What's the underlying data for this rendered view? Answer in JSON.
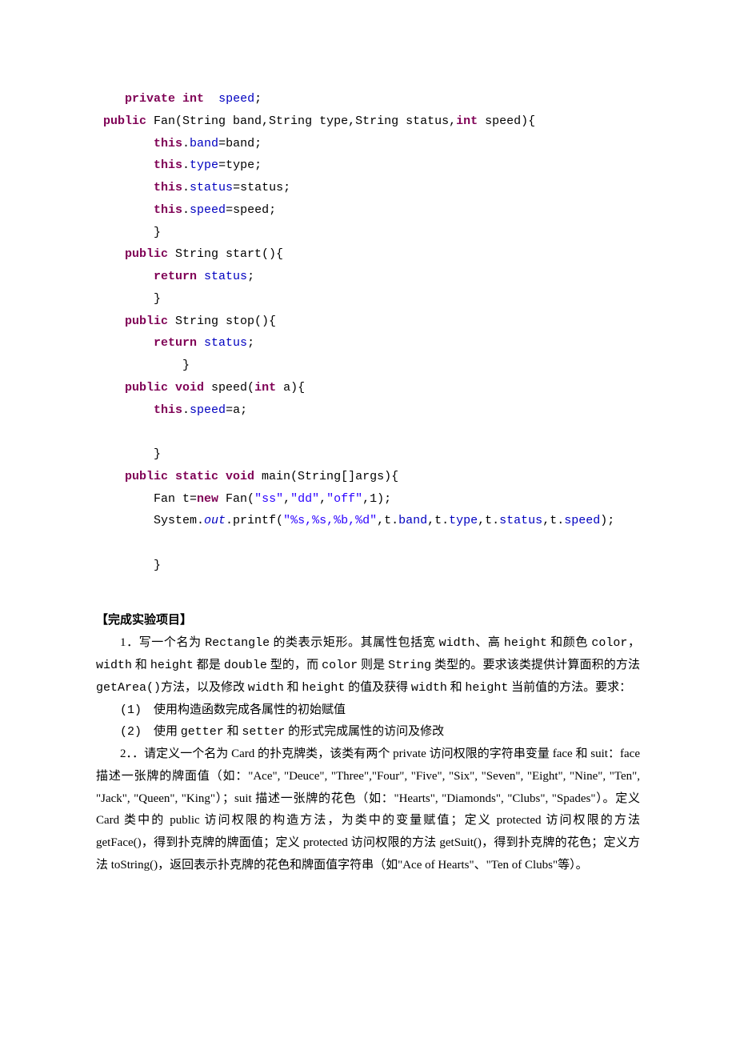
{
  "code": {
    "lines": [
      {
        "indent": "    ",
        "tokens": [
          {
            "t": "private int",
            "c": "kw"
          },
          {
            "t": "  "
          },
          {
            "t": "speed",
            "c": "field"
          },
          {
            "t": ";"
          }
        ]
      },
      {
        "indent": " ",
        "tokens": [
          {
            "t": "public",
            "c": "kw"
          },
          {
            "t": " Fan(String band,String type,String status,"
          },
          {
            "t": "int",
            "c": "kw"
          },
          {
            "t": " speed){"
          }
        ]
      },
      {
        "indent": "        ",
        "tokens": [
          {
            "t": "this",
            "c": "kw"
          },
          {
            "t": "."
          },
          {
            "t": "band",
            "c": "field"
          },
          {
            "t": "=band;"
          }
        ]
      },
      {
        "indent": "        ",
        "tokens": [
          {
            "t": "this",
            "c": "kw"
          },
          {
            "t": "."
          },
          {
            "t": "type",
            "c": "field"
          },
          {
            "t": "=type;"
          }
        ]
      },
      {
        "indent": "        ",
        "tokens": [
          {
            "t": "this",
            "c": "kw"
          },
          {
            "t": "."
          },
          {
            "t": "status",
            "c": "field"
          },
          {
            "t": "=status;"
          }
        ]
      },
      {
        "indent": "        ",
        "tokens": [
          {
            "t": "this",
            "c": "kw"
          },
          {
            "t": "."
          },
          {
            "t": "speed",
            "c": "field"
          },
          {
            "t": "=speed;"
          }
        ]
      },
      {
        "indent": "        ",
        "tokens": [
          {
            "t": "}"
          }
        ]
      },
      {
        "indent": "    ",
        "tokens": [
          {
            "t": "public",
            "c": "kw"
          },
          {
            "t": " String start(){"
          }
        ]
      },
      {
        "indent": "        ",
        "tokens": [
          {
            "t": "return",
            "c": "kw"
          },
          {
            "t": " "
          },
          {
            "t": "status",
            "c": "field"
          },
          {
            "t": ";"
          }
        ]
      },
      {
        "indent": "        ",
        "tokens": [
          {
            "t": "}"
          }
        ]
      },
      {
        "indent": "    ",
        "tokens": [
          {
            "t": "public",
            "c": "kw"
          },
          {
            "t": " String stop(){"
          }
        ]
      },
      {
        "indent": "        ",
        "tokens": [
          {
            "t": "return",
            "c": "kw"
          },
          {
            "t": " "
          },
          {
            "t": "status",
            "c": "field"
          },
          {
            "t": ";"
          }
        ]
      },
      {
        "indent": "            ",
        "tokens": [
          {
            "t": "}"
          }
        ]
      },
      {
        "indent": "    ",
        "tokens": [
          {
            "t": "public void",
            "c": "kw"
          },
          {
            "t": " speed("
          },
          {
            "t": "int",
            "c": "kw"
          },
          {
            "t": " a){"
          }
        ]
      },
      {
        "indent": "        ",
        "tokens": [
          {
            "t": "this",
            "c": "kw"
          },
          {
            "t": "."
          },
          {
            "t": "speed",
            "c": "field"
          },
          {
            "t": "=a;"
          }
        ]
      },
      {
        "indent": "",
        "tokens": [
          {
            "t": " "
          }
        ]
      },
      {
        "indent": "        ",
        "tokens": [
          {
            "t": "}"
          }
        ]
      },
      {
        "indent": "    ",
        "tokens": [
          {
            "t": "public static void",
            "c": "kw"
          },
          {
            "t": " main(String[]args){"
          }
        ]
      },
      {
        "indent": "        ",
        "tokens": [
          {
            "t": "Fan t="
          },
          {
            "t": "new",
            "c": "kw"
          },
          {
            "t": " Fan("
          },
          {
            "t": "\"ss\"",
            "c": "str"
          },
          {
            "t": ","
          },
          {
            "t": "\"dd\"",
            "c": "str"
          },
          {
            "t": ","
          },
          {
            "t": "\"off\"",
            "c": "str"
          },
          {
            "t": ",1);"
          }
        ]
      },
      {
        "indent": "        ",
        "tokens": [
          {
            "t": "System."
          },
          {
            "t": "out",
            "c": "static-ital"
          },
          {
            "t": ".printf("
          },
          {
            "t": "\"%s,%s,%b,%d\"",
            "c": "str"
          },
          {
            "t": ",t."
          },
          {
            "t": "band",
            "c": "field"
          },
          {
            "t": ",t."
          },
          {
            "t": "type",
            "c": "field"
          },
          {
            "t": ",t."
          },
          {
            "t": "status",
            "c": "field"
          },
          {
            "t": ",t."
          },
          {
            "t": "speed",
            "c": "field"
          },
          {
            "t": ");"
          }
        ]
      },
      {
        "indent": "",
        "tokens": [
          {
            "t": " "
          }
        ]
      },
      {
        "indent": "        ",
        "tokens": [
          {
            "t": "}"
          }
        ]
      }
    ]
  },
  "prose": {
    "heading": "【完成实验项目】",
    "p1_pre": "1．写一个名为 ",
    "p1_rect": "Rectangle",
    "p1_mid1": " 的类表示矩形。其属性包括宽 ",
    "p1_width": "width",
    "p1_mid2": "、高 ",
    "p1_height": "height",
    "p1_mid3": " 和颜色 ",
    "p1_color": "color",
    "p1_mid4": "，",
    "p1_line2a": "width",
    "p1_line2b": " 和 ",
    "p1_line2c": "height",
    "p1_line2d": " 都是 ",
    "p1_line2e": "double",
    "p1_line2f": " 型的，而 ",
    "p1_line2g": "color",
    "p1_line2h": " 则是 ",
    "p1_line2i": "String",
    "p1_line2j": " 类型的。要求该类提供计算面积的方法 ",
    "p1_line3a": "getArea()",
    "p1_line3b": "方法，以及修改 ",
    "p1_line3c": "width",
    "p1_line3d": " 和 ",
    "p1_line3e": "height",
    "p1_line3f": " 的值及获得 ",
    "p1_line3g": "width",
    "p1_line3h": " 和 ",
    "p1_line3i": "height",
    "p1_line3j": " 当前值的方法。要求：",
    "li1_num": "(1)",
    "li1_text": "使用构造函数完成各属性的初始赋值",
    "li2_num": "(2)",
    "li2_text_a": "使用 ",
    "li2_text_b": "getter",
    "li2_text_c": " 和 ",
    "li2_text_d": "setter",
    "li2_text_e": " 的形式完成属性的访问及修改",
    "p2_full": "2．．请定义一个名为 Card 的扑克牌类，该类有两个 private 访问权限的字符串变量 face 和 suit：face 描述一张牌的牌面值（如：\"Ace\", \"Deuce\", \"Three\",\"Four\", \"Five\", \"Six\", \"Seven\", \"Eight\", \"Nine\", \"Ten\", \"Jack\", \"Queen\", \"King\"）；suit 描述一张牌的花色（如：\"Hearts\", \"Diamonds\", \"Clubs\", \"Spades\"）。定义 Card 类中的 public 访问权限的构造方法，为类中的变量赋值；定义 protected 访问权限的方法 getFace()，得到扑克牌的牌面值；定义 protected 访问权限的方法 getSuit()，得到扑克牌的花色；定义方法 toString()，返回表示扑克牌的花色和牌面值字符串（如\"Ace of Hearts\"、\"Ten of Clubs\"等）。"
  }
}
